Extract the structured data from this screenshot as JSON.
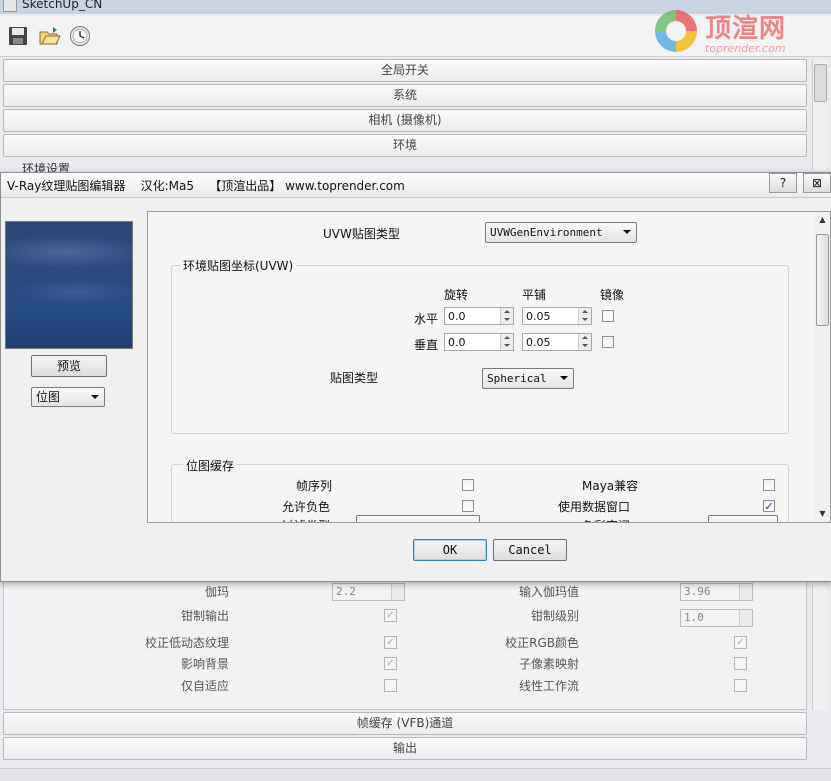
{
  "background_window": {
    "title": "SketchUp_CN",
    "toolbar": {
      "save_icon": "save-icon",
      "open_icon": "open-folder-icon",
      "clock_icon": "clock-icon"
    },
    "sections": [
      "全局开关",
      "系统",
      "相机 (摄像机)",
      "环境"
    ],
    "partial_text": "环境设置",
    "lower_panel": {
      "gamma_label": "伽玛",
      "gamma_value": "2.2",
      "input_gamma_label": "输入伽玛值",
      "input_gamma_value": "3.96",
      "clamp_output": "钳制输出",
      "clamp_level_label": "钳制级别",
      "clamp_level_value": "1.0",
      "correct_ldr": "校正低动态纹理",
      "correct_rgb": "校正RGB颜色",
      "affect_background": "影响背景",
      "subpixel": "子像素映射",
      "adaptive_only": "仅自适应",
      "linear_workflow": "线性工作流"
    },
    "bottom_sections": [
      "帧缓存 (VFB)通道",
      "输出"
    ]
  },
  "watermark": {
    "cn": "顶渲网",
    "en": "toprender.com"
  },
  "dialog": {
    "title": "V-Ray纹理贴图编辑器    汉化:Ma5    【顶渲出品】 www.toprender.com",
    "help_label": "?",
    "close_label": "⊠",
    "preview_button": "预览",
    "type_combo": "位图",
    "uvw_type_label": "UVW贴图类型",
    "uvw_type_value": "UVWGenEnvironment",
    "env_group": {
      "title": "环境贴图坐标(UVW)",
      "col_rotate": "旋转",
      "col_tile": "平铺",
      "col_mirror": "镜像",
      "row_h_label": "水平",
      "row_h_rotate": "0.0",
      "row_h_tile": "0.05",
      "row_v_label": "垂直",
      "row_v_rotate": "0.0",
      "row_v_tile": "0.05",
      "map_type_label": "贴图类型",
      "map_type_value": "Spherical"
    },
    "bitmap_group": {
      "title": "位图缓存",
      "frame_seq": "帧序列",
      "maya_compat": "Maya兼容",
      "allow_negative": "允许负色",
      "use_data_window": "使用数据窗口",
      "use_data_window_checked": true,
      "filter_type": "过滤类型",
      "multi_color": "色彩空间"
    },
    "ok_label": "OK",
    "cancel_label": "Cancel"
  }
}
